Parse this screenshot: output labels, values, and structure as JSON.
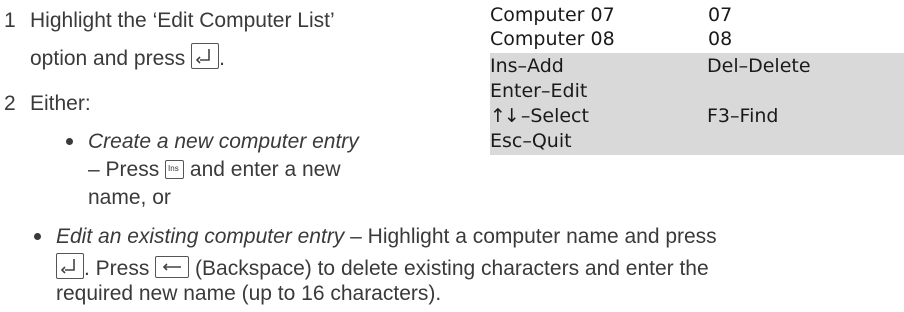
{
  "steps": [
    {
      "number": "1",
      "line1": "Highlight the ‘Edit Computer List’",
      "line2_prefix": "option and press",
      "line2_suffix": "."
    },
    {
      "number": "2",
      "intro": "Either:",
      "bullets": [
        {
          "lead": "Create a new computer entry",
          "line2_prefix": "– Press",
          "line2_suffix": "and enter a new",
          "line3": "name, or"
        },
        {
          "lead": "Edit an existing computer entry",
          "line1_rest": " – Highlight a computer name and press",
          "line2_mid": ". Press",
          "line2_backspace": "(Backspace) to delete existing characters and enter the",
          "line3": "required new name (up to 16 characters)."
        }
      ]
    }
  ],
  "keys": {
    "ins_label": "Ins",
    "enter_icon": "enter-key-icon",
    "backspace_icon": "backspace-key-icon"
  },
  "osd": {
    "computers": [
      {
        "name": "Computer 07",
        "code": "07"
      },
      {
        "name": "Computer 08",
        "code": "08"
      }
    ],
    "commands": {
      "ins": "Ins–Add",
      "del": "Del–Delete",
      "enter": "Enter–Edit",
      "select_arrows": "↑↓",
      "select": "–Select",
      "find": "F3–Find",
      "esc": "Esc–Quit"
    }
  }
}
